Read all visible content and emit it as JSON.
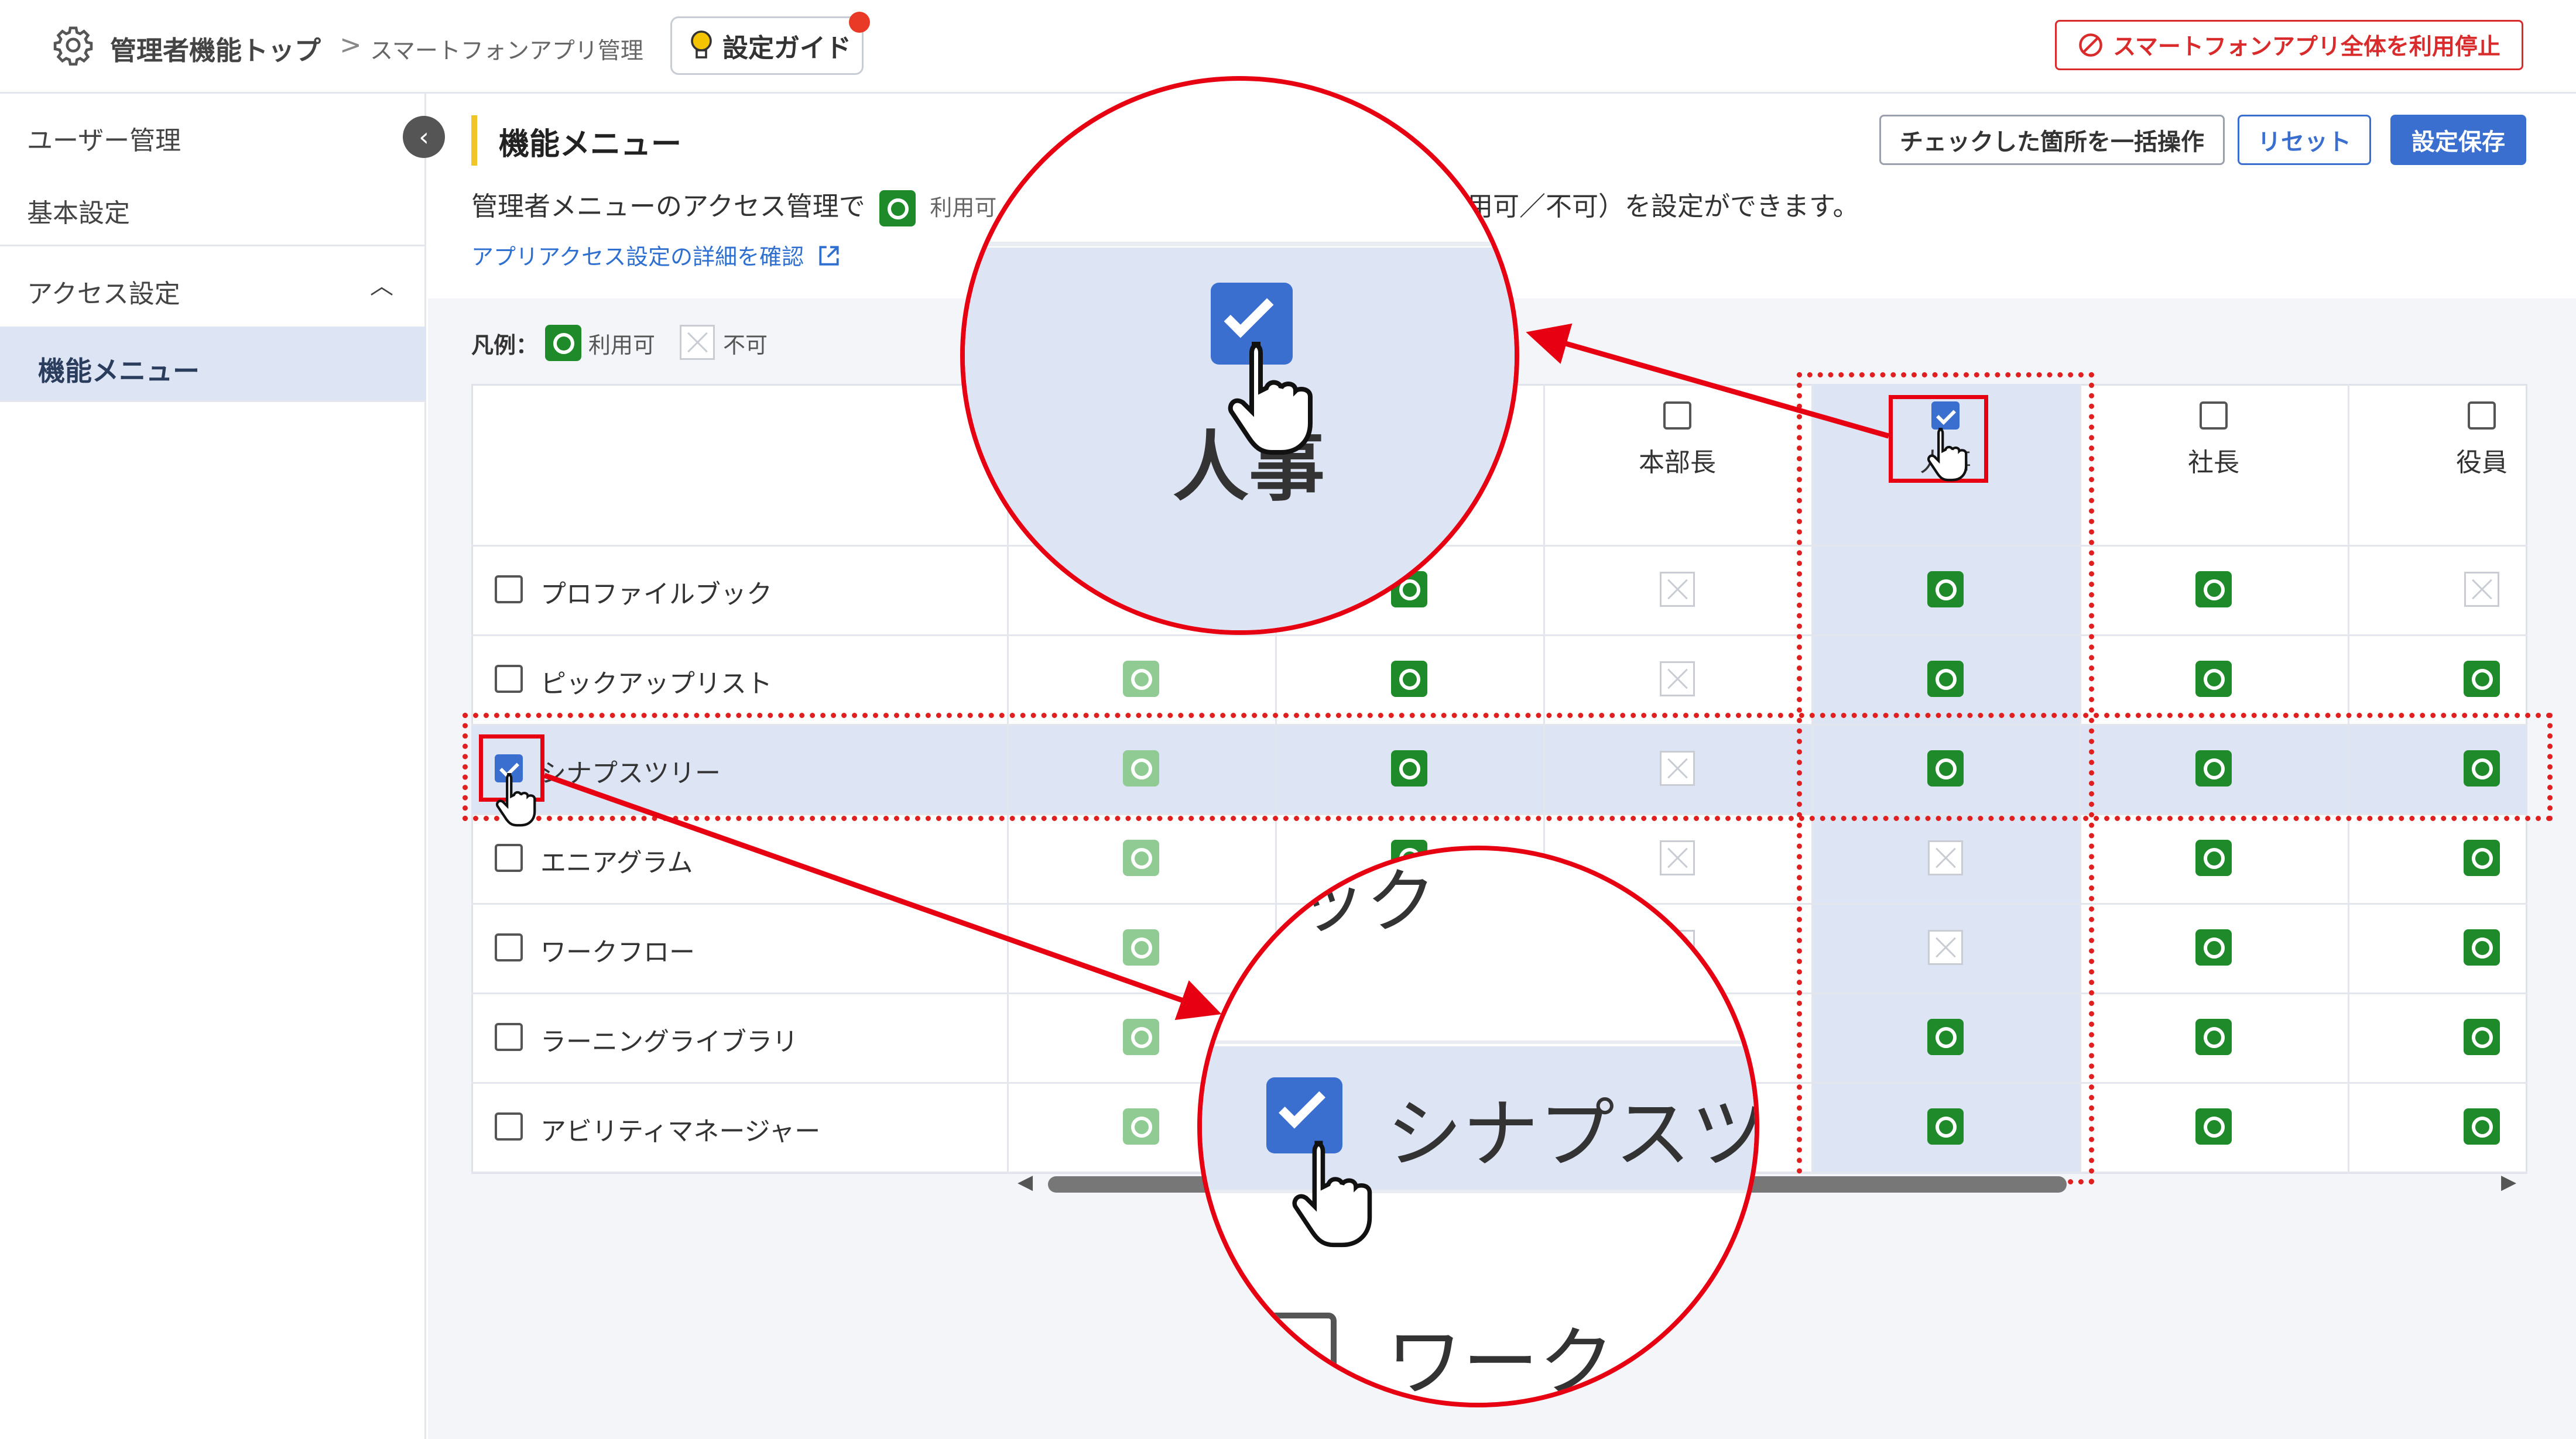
{
  "header": {
    "title": "管理者機能トップ",
    "sep": ">",
    "subtitle": "スマートフォンアプリ管理",
    "guide_label": "設定ガイド",
    "stop_label": "スマートフォンアプリ全体を利用停止"
  },
  "sidebar": {
    "items": [
      {
        "label": "ユーザー管理"
      },
      {
        "label": "基本設定"
      },
      {
        "label": "アクセス設定"
      },
      {
        "label": "機能メニュー"
      }
    ]
  },
  "page": {
    "title": "機能メニュー",
    "bulk_label": "チェックした箇所を一括操作",
    "reset_label": "リセット",
    "save_label": "設定保存",
    "desc_start": "管理者メニューのアクセス管理で",
    "desc_available": "利用可",
    "desc_end": "用可／不可）を設定ができます。",
    "detail_link": "アプリアクセス設定の詳細を確認"
  },
  "legend": {
    "title": "凡例：",
    "available": "利用可",
    "unavailable": "不可"
  },
  "table": {
    "columns": [
      "本部長",
      "人事",
      "社長",
      "役員"
    ],
    "rows": [
      {
        "label": "プロファイルブック"
      },
      {
        "label": "ピックアップリスト"
      },
      {
        "label": "シナプスツリー"
      },
      {
        "label": "エニアグラム"
      },
      {
        "label": "ワークフロー"
      },
      {
        "label": "ラーニングライブラリ"
      },
      {
        "label": "アビリティマネージャー"
      }
    ]
  },
  "zoom": {
    "top_text": "人事",
    "bottom_row1": "ピック",
    "bottom_row2": "シナプスツ",
    "bottom_row3": "ワーク"
  },
  "colors": {
    "accent": "#3a6fd0",
    "available": "#1f8a2a",
    "callout": "#e60012",
    "danger": "#d92b2b"
  }
}
